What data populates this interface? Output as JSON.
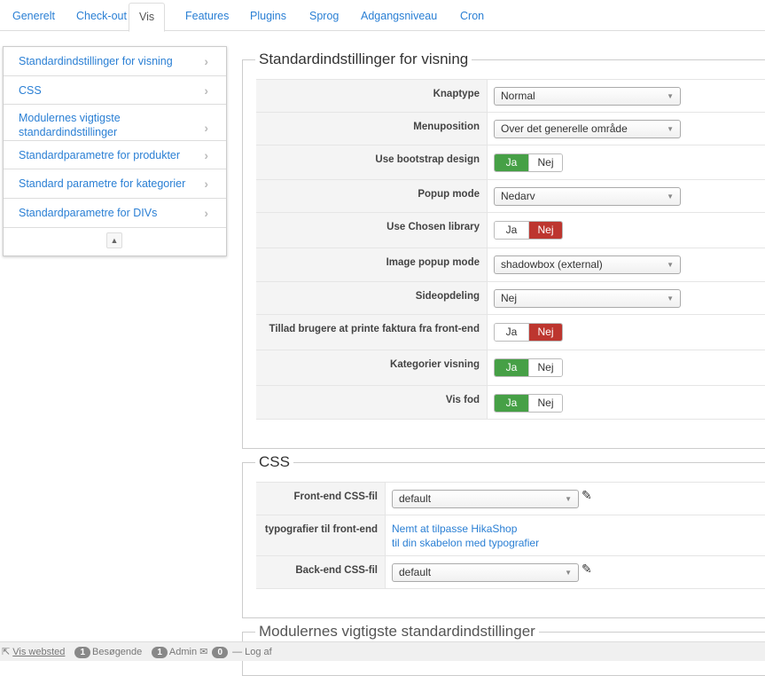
{
  "tabs": [
    "Generelt",
    "Check-out",
    "Vis",
    "Features",
    "Plugins",
    "Sprog",
    "Adgangsniveau",
    "Cron"
  ],
  "active_tab": "Vis",
  "sidebar": {
    "items": [
      "Standardindstillinger for visning",
      "CSS",
      "Modulernes vigtigste standardindstillinger",
      "Standardparametre for produkter",
      "Standard parametre for kategorier",
      "Standardparametre for DIVs"
    ]
  },
  "section1": {
    "title": "Standardindstillinger for visning",
    "rows": [
      {
        "label": "Knaptype",
        "type": "select",
        "value": "Normal"
      },
      {
        "label": "Menuposition",
        "type": "select",
        "value": "Over det generelle område"
      },
      {
        "label": "Use bootstrap design",
        "type": "toggle",
        "yes": "Ja",
        "no": "Nej",
        "value": "Ja"
      },
      {
        "label": "Popup mode",
        "type": "select",
        "value": "Nedarv"
      },
      {
        "label": "Use Chosen library",
        "type": "toggle",
        "yes": "Ja",
        "no": "Nej",
        "value": "Nej"
      },
      {
        "label": "Image popup mode",
        "type": "select",
        "value": "shadowbox (external)"
      },
      {
        "label": "Sideopdeling",
        "type": "select",
        "value": "Nej"
      },
      {
        "label": "Tillad brugere at printe faktura fra front-end",
        "type": "toggle",
        "yes": "Ja",
        "no": "Nej",
        "value": "Nej"
      },
      {
        "label": "Kategorier visning",
        "type": "toggle",
        "yes": "Ja",
        "no": "Nej",
        "value": "Ja"
      },
      {
        "label": "Vis fod",
        "type": "toggle",
        "yes": "Ja",
        "no": "Nej",
        "value": "Ja"
      }
    ]
  },
  "section2": {
    "title": "CSS",
    "frontend_label": "Front-end CSS-fil",
    "frontend_value": "default",
    "typo_label": "typografier til front-end",
    "typo_link1": "Nemt at tilpasse HikaShop",
    "typo_link2": "til din skabelon med typografier",
    "backend_label": "Back-end CSS-fil",
    "backend_value": "default"
  },
  "section3": {
    "title": "Modulernes vigtigste standardindstillinger"
  },
  "statusbar": {
    "view_site": "Vis websted",
    "visitors_count": "1",
    "visitors": "Besøgende",
    "admin_count": "1",
    "admin": "Admin",
    "messages_count": "0",
    "logout": "Log af"
  },
  "colors": {
    "link": "#2a7fd4",
    "yes_active": "#46a046",
    "no_active": "#bd362f"
  }
}
